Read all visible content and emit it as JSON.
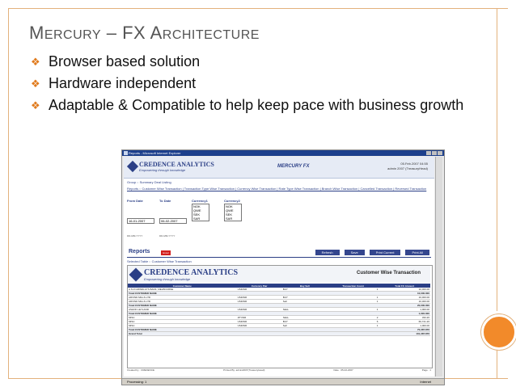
{
  "slide": {
    "title_first": "M",
    "title_first_rest": "ERCURY",
    "title_mid": " – FX A",
    "title_last_rest": "RCHITECTURE",
    "bullets": [
      "Browser based solution",
      "Hardware independent",
      "Adaptable & Compatible to help keep pace with business growth"
    ],
    "bullet_glyph": "❖",
    "accent_color": "#e07a1c"
  },
  "screenshot": {
    "window_title": "Reports - Microsoft Internet Explorer",
    "status_left": "Processing: 1",
    "status_right": "Internet",
    "header": {
      "logo_text": "CREDENCE ANALYTICS",
      "logo_tagline": "Empowering through knowledge",
      "product": "MERCURY FX",
      "user_line1": "05.Feb.2007 04:55",
      "user_line2": "admin 2007 (TreasuryHead)"
    },
    "nav": "Group :: Summary  Deal Listing",
    "report_tabs": "Reports :: Customer Wise Transaction | Transaction Type Wise Transaction | Currency Wise Transaction | Rate Type Wise Transaction | Branch Wise Transaction | Cancelled Transaction | Reversed Transaction",
    "filters": {
      "from_label": "From Date",
      "to_label": "To Date",
      "currency1_label": "Currency1",
      "currency2_label": "Currency2",
      "from_value": "16-01-2007",
      "to_value": "06-02-2007",
      "currency1_options": [
        "NOK",
        "QWE",
        "SEK",
        "SAR"
      ],
      "currency2_options": [
        "NOK",
        "QWE",
        "SEK",
        "SAR"
      ],
      "date_hint": "DD-MM-YYYY"
    },
    "reports_title": "Reports",
    "reports_badge": "Excel",
    "buttons": [
      "Refresh",
      "Save",
      "Print Current",
      "Print All"
    ],
    "selected_table": "Selected Table :: Customer Wise Transaction",
    "report": {
      "logo_text": "CREDENCE ANALYTICS",
      "logo_tagline": "Empowering through knowledge",
      "title": "Customer Wise Transaction",
      "columns": [
        "Customer Name",
        "Currency Pair",
        "Buy Sell",
        "Transaction Count",
        "Total FC Amount"
      ],
      "rows": [
        {
          "cells": [
            "A.N.Z.GRINDLAYS BANK, MELBOURNE",
            "USDINR",
            "BUY",
            "1",
            "10,000.00"
          ],
          "total": false
        },
        {
          "cells": [
            "Total:CUSTOMER NAME",
            "",
            "",
            "",
            "10,000.000"
          ],
          "total": true
        },
        {
          "cells": [
            "ARVIND MILLS LTD",
            "USDINR",
            "BUY",
            "1",
            "10,000.00"
          ],
          "total": false
        },
        {
          "cells": [
            "ARVIND MILLS LTD",
            "USDINR",
            "Sell",
            "1",
            "10,000.00"
          ],
          "total": false
        },
        {
          "cells": [
            "Total:CUSTOMER NAME",
            "",
            "",
            "",
            "20,000.000"
          ],
          "total": true
        },
        {
          "cells": [
            "ASHOK LEYLAND",
            "USDINR",
            "SELL",
            "1",
            "1,000.00"
          ],
          "total": false
        },
        {
          "cells": [
            "Total:CUSTOMER NAME",
            "",
            "",
            "",
            "1,000.000"
          ],
          "total": true
        },
        {
          "cells": [
            "MISC",
            "JPYINR",
            "SELL",
            "2",
            "333.26"
          ],
          "total": false
        },
        {
          "cells": [
            "MISC",
            "USDINR",
            "BUY",
            "6",
            "69,721.26"
          ],
          "total": false
        },
        {
          "cells": [
            "MISC",
            "USDINR",
            "Sell",
            "1",
            "1,000.00"
          ],
          "total": false
        },
        {
          "cells": [
            "Total:CUSTOMER NAME",
            "",
            "",
            "",
            "70,387.876"
          ],
          "total": true
        },
        {
          "cells": [
            "Grand Total",
            "",
            "",
            "",
            "101,387.876"
          ],
          "total": true
        }
      ]
    },
    "footer": {
      "created_by": "Created by : CREDENCE",
      "printed_by": "Printed By: admin2007(TreasuryHead)",
      "date": "Date : 05-02-2007",
      "page": "Page : 1"
    }
  }
}
